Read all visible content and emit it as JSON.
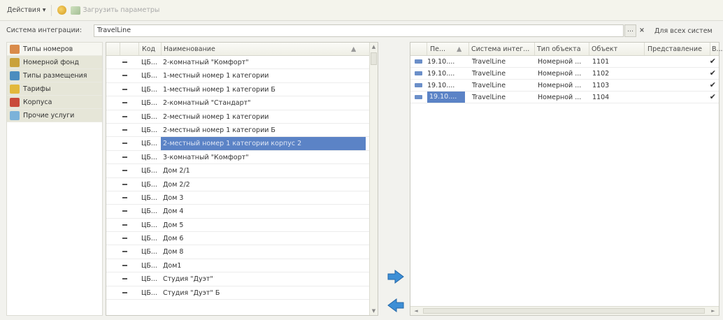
{
  "toolbar": {
    "actions_label": "Действия ▾",
    "load_params_label": "Загрузить параметры"
  },
  "system": {
    "label": "Система интеграции:",
    "value": "TravelLine",
    "choose_btn": "...",
    "clear_btn": "×",
    "all_systems_label": "Для всех систем"
  },
  "tabs": [
    {
      "label": "Типы номеров",
      "icon": "room-types-icon",
      "color": "#d98b4a"
    },
    {
      "label": "Номерной фонд",
      "icon": "room-stock-icon",
      "color": "#c9a23b"
    },
    {
      "label": "Типы размещения",
      "icon": "placement-types-icon",
      "color": "#4c8dbf"
    },
    {
      "label": "Тарифы",
      "icon": "tariffs-icon",
      "color": "#e2b83c"
    },
    {
      "label": "Корпуса",
      "icon": "buildings-icon",
      "color": "#c94a3a"
    },
    {
      "label": "Прочие услуги",
      "icon": "other-services-icon",
      "color": "#7bb2d9"
    }
  ],
  "mid_table": {
    "columns": [
      "Код",
      "Наименование"
    ],
    "rows": [
      {
        "code": "ЦБ...",
        "name": "2-комнатный \"Комфорт\""
      },
      {
        "code": "ЦБ...",
        "name": "1-местный номер 1 категории"
      },
      {
        "code": "ЦБ...",
        "name": "1-местный номер 1 категории Б"
      },
      {
        "code": "ЦБ...",
        "name": "2-комнатный \"Стандарт\""
      },
      {
        "code": "ЦБ...",
        "name": "2-местный номер 1 категории"
      },
      {
        "code": "ЦБ...",
        "name": "2-местный номер 1 категории Б"
      },
      {
        "code": "ЦБ...",
        "name": "2-местный номер 1 категории корпус 2"
      },
      {
        "code": "ЦБ...",
        "name": "3-комнатный \"Комфорт\""
      },
      {
        "code": "ЦБ...",
        "name": "Дом 2/1"
      },
      {
        "code": "ЦБ...",
        "name": "Дом 2/2"
      },
      {
        "code": "ЦБ...",
        "name": "Дом 3"
      },
      {
        "code": "ЦБ...",
        "name": "Дом 4"
      },
      {
        "code": "ЦБ...",
        "name": "Дом 5"
      },
      {
        "code": "ЦБ...",
        "name": "Дом 6"
      },
      {
        "code": "ЦБ...",
        "name": "Дом 8"
      },
      {
        "code": "ЦБ...",
        "name": "Дом1"
      },
      {
        "code": "ЦБ...",
        "name": "Студия \"Дуэт\""
      },
      {
        "code": "ЦБ...",
        "name": "Студия \"Дуэт\" Б"
      }
    ],
    "selected_index": 6
  },
  "right_table": {
    "columns": [
      "Пе...",
      "Система интег...",
      "Тип объекта",
      "Объект",
      "Представление",
      "В..."
    ],
    "rows": [
      {
        "date": "19.10....",
        "system": "TravelLine",
        "type": "Номерной ...",
        "object": "1101",
        "checked": "✔"
      },
      {
        "date": "19.10....",
        "system": "TravelLine",
        "type": "Номерной ...",
        "object": "1102",
        "checked": "✔"
      },
      {
        "date": "19.10....",
        "system": "TravelLine",
        "type": "Номерной ...",
        "object": "1103",
        "checked": "✔"
      },
      {
        "date": "19.10....",
        "system": "TravelLine",
        "type": "Номерной ...",
        "object": "1104",
        "checked": "✔"
      }
    ],
    "selected_index": 3
  }
}
